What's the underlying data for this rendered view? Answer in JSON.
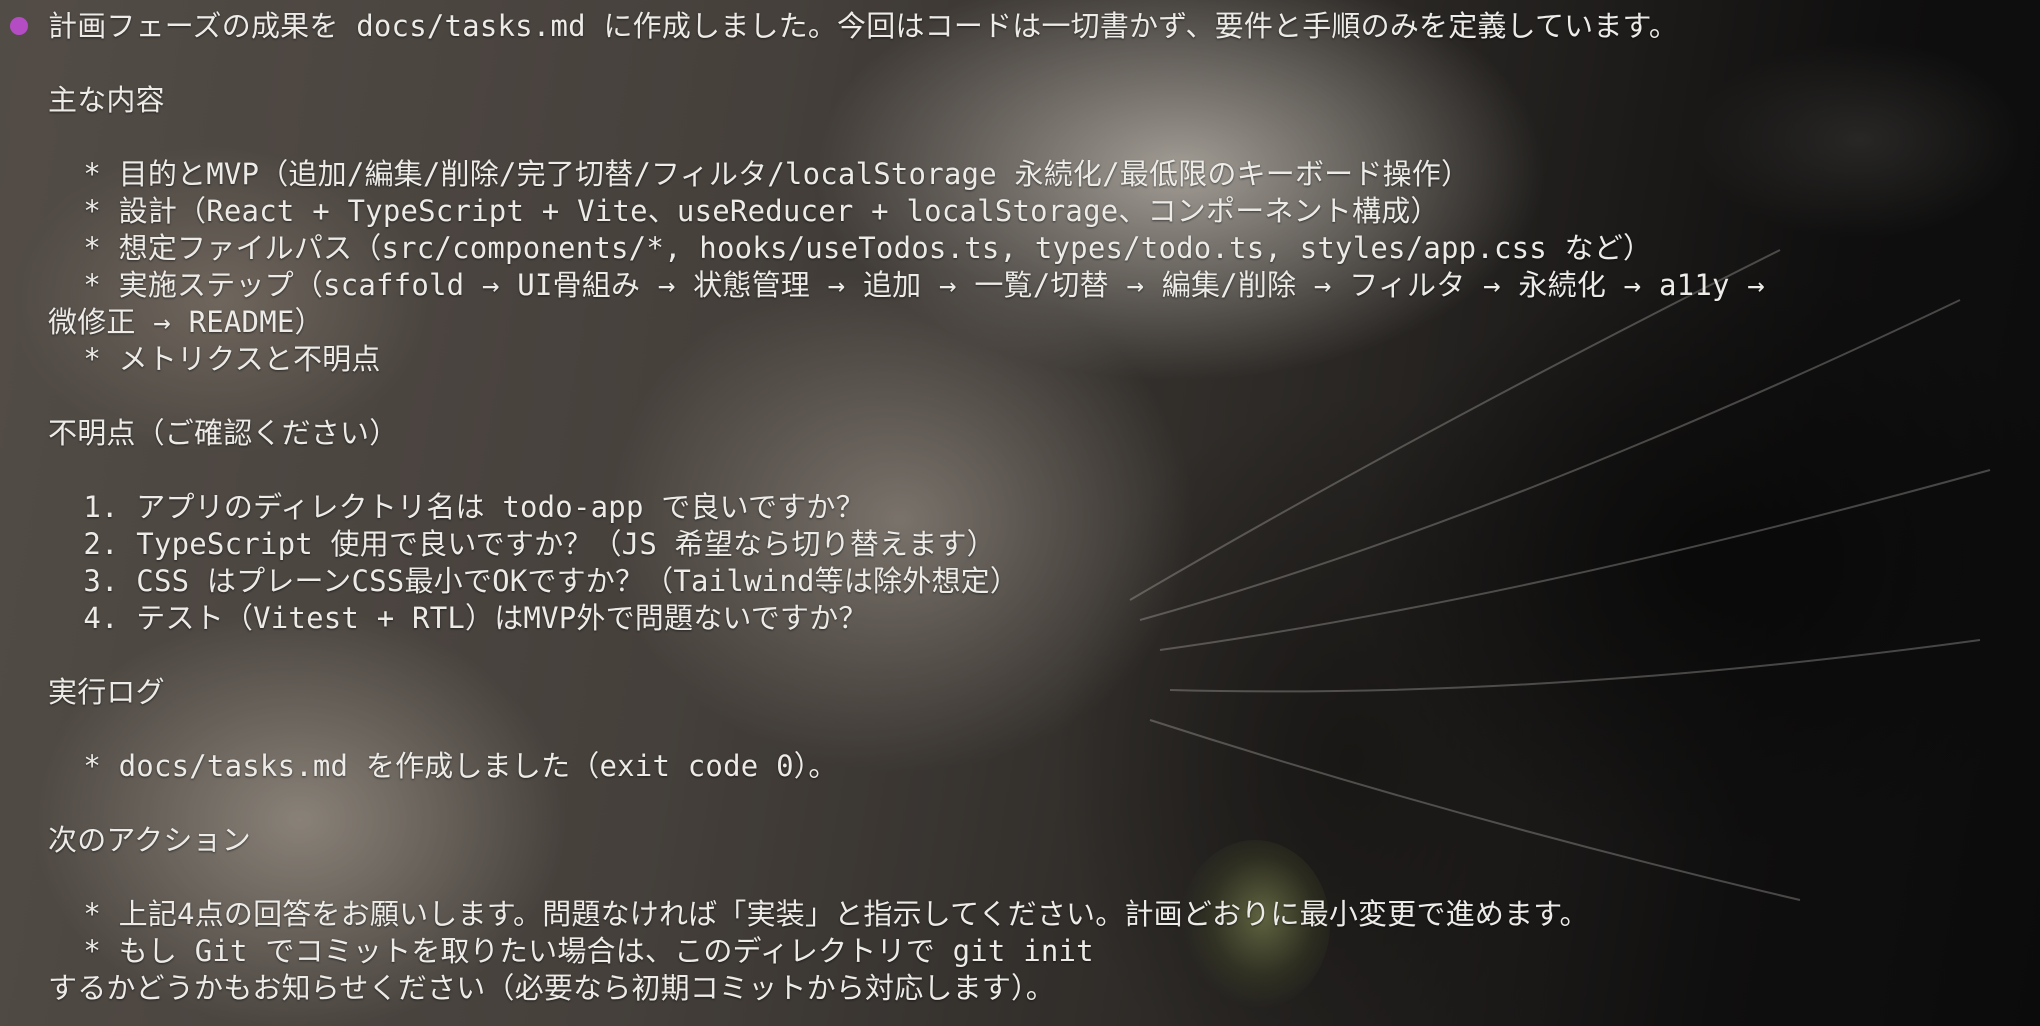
{
  "message": {
    "bullet_color": "#b44cc4",
    "lines": [
      "計画フェーズの成果を docs/tasks.md に作成しました。今回はコードは一切書かず、要件と手順のみを定義しています。",
      "主な内容",
      "  * 目的とMVP（追加/編集/削除/完了切替/フィルタ/localStorage 永続化/最低限のキーボード操作）",
      "  * 設計（React + TypeScript + Vite、useReducer + localStorage、コンポーネント構成）",
      "  * 想定ファイルパス（src/components/*, hooks/useTodos.ts, types/todo.ts, styles/app.css など）",
      "  * 実施ステップ（scaffold → UI骨組み → 状態管理 → 追加 → 一覧/切替 → 編集/削除 → フィルタ → 永続化 → a11y →",
      "微修正 → README）",
      "  * メトリクスと不明点",
      "不明点（ご確認ください）",
      "  1. アプリのディレクトリ名は todo-app で良いですか？",
      "  2. TypeScript 使用で良いですか？（JS 希望なら切り替えます）",
      "  3. CSS はプレーンCSS最小でOKですか？（Tailwind等は除外想定）",
      "  4. テスト（Vitest + RTL）はMVP外で問題ないですか？",
      "実行ログ",
      "  * docs/tasks.md を作成しました（exit code 0）。",
      "次のアクション",
      "  * 上記4点の回答をお願いします。問題なければ「実装」と指示してください。計画どおりに最小変更で進めます。",
      "  * もし Git でコミットを取りたい場合は、このディレクトリで git init",
      "するかどうかもお知らせください（必要なら初期コミットから対応します）。"
    ]
  }
}
